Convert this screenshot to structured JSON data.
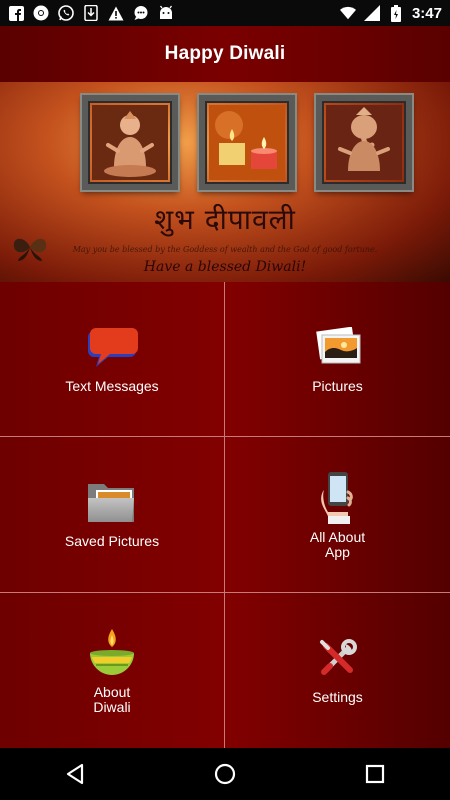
{
  "status_bar": {
    "time": "3:47",
    "icons": [
      "facebook-icon",
      "chrome-icon",
      "whatsapp-icon",
      "download-icon",
      "warning-icon",
      "chat-icon",
      "android-icon",
      "wifi-icon",
      "signal-icon",
      "battery-icon"
    ]
  },
  "app_bar": {
    "title": "Happy Diwali"
  },
  "banner": {
    "shubh_text": "शुभ दीपावली",
    "blessing_text": "May you be blessed by the Goddess of wealth and the God of good fortune.",
    "blessed_text": "Have  a blessed Diwali!"
  },
  "menu": {
    "items": [
      {
        "label": "Text Messages",
        "icon": "speech-bubble-icon"
      },
      {
        "label": "Pictures",
        "icon": "photos-icon"
      },
      {
        "label": "Saved Pictures",
        "icon": "folder-pictures-icon"
      },
      {
        "label": "All About\nApp",
        "icon": "phone-hand-icon"
      },
      {
        "label": "About\nDiwali",
        "icon": "diya-icon"
      },
      {
        "label": "Settings",
        "icon": "tools-icon"
      }
    ]
  },
  "colors": {
    "app_bar": "#6e0000",
    "grid_bg": "#7a0000",
    "divider": "#c87a7a"
  }
}
